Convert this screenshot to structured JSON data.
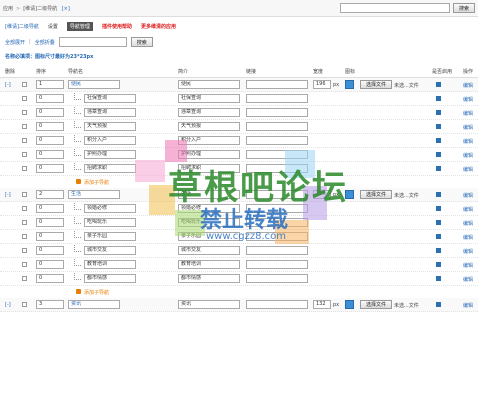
{
  "topbar": {
    "crumb_a": "应用",
    "crumb_sep": ">",
    "crumb_b": "[维请]二级导航",
    "crumb_close": "[×]",
    "search_placeholder": "",
    "search_btn": "搜索"
  },
  "subnav": {
    "site": "[维请]二级导航",
    "settings": "设置",
    "manage": "导航管理",
    "red1": "插件使用帮助",
    "red2": "更多维清的应用"
  },
  "tools": {
    "expand": "全部展开",
    "sep": "|",
    "collapse": "全部折叠",
    "search_btn": "搜索"
  },
  "note": "名称必填项：图标尺寸最好为23*23px",
  "headers": {
    "del": "删除",
    "order": "排序",
    "name": "导航名",
    "intro": "简介",
    "link": "链接",
    "width": "宽度",
    "icon": "图标",
    "enabled": "是否启用",
    "op": "操作"
  },
  "common": {
    "px": "px",
    "choose_file": "选择文件",
    "no_file": "未选...文件",
    "edit": "编辑",
    "add_child": "添加子导航",
    "toggle": "[-]"
  },
  "groups": [
    {
      "order": "1",
      "name": "便民",
      "intro": "便民",
      "width": "196",
      "children": [
        {
          "order": "0",
          "name": "社保查询",
          "intro": "社保查询"
        },
        {
          "order": "0",
          "name": "违章查询",
          "intro": "违章查询"
        },
        {
          "order": "0",
          "name": "天气预报",
          "intro": "天气预报"
        },
        {
          "order": "0",
          "name": "积分入户",
          "intro": "积分入户"
        },
        {
          "order": "0",
          "name": "护照办理",
          "intro": "护照办理"
        },
        {
          "order": "0",
          "name": "招聘求职",
          "intro": "招聘求职"
        }
      ]
    },
    {
      "order": "2",
      "name": "生活",
      "intro": "生活",
      "width": "196",
      "children": [
        {
          "order": "0",
          "name": "领婚必修",
          "intro": "领婚必修"
        },
        {
          "order": "0",
          "name": "吃喝玩乐",
          "intro": "吃喝玩乐"
        },
        {
          "order": "0",
          "name": "亲子乐园",
          "intro": "亲子乐园"
        },
        {
          "order": "0",
          "name": "城市交友",
          "intro": "城市交友"
        },
        {
          "order": "0",
          "name": "教育培训",
          "intro": "教育培训"
        },
        {
          "order": "0",
          "name": "都市情感",
          "intro": "都市情感"
        }
      ]
    },
    {
      "order": "3",
      "name": "资讯",
      "intro": "资讯",
      "width": "132",
      "children": []
    }
  ],
  "watermark": {
    "line1": "草根吧论坛",
    "line2": "禁止转载",
    "line3": "www.cgzz8.com"
  }
}
